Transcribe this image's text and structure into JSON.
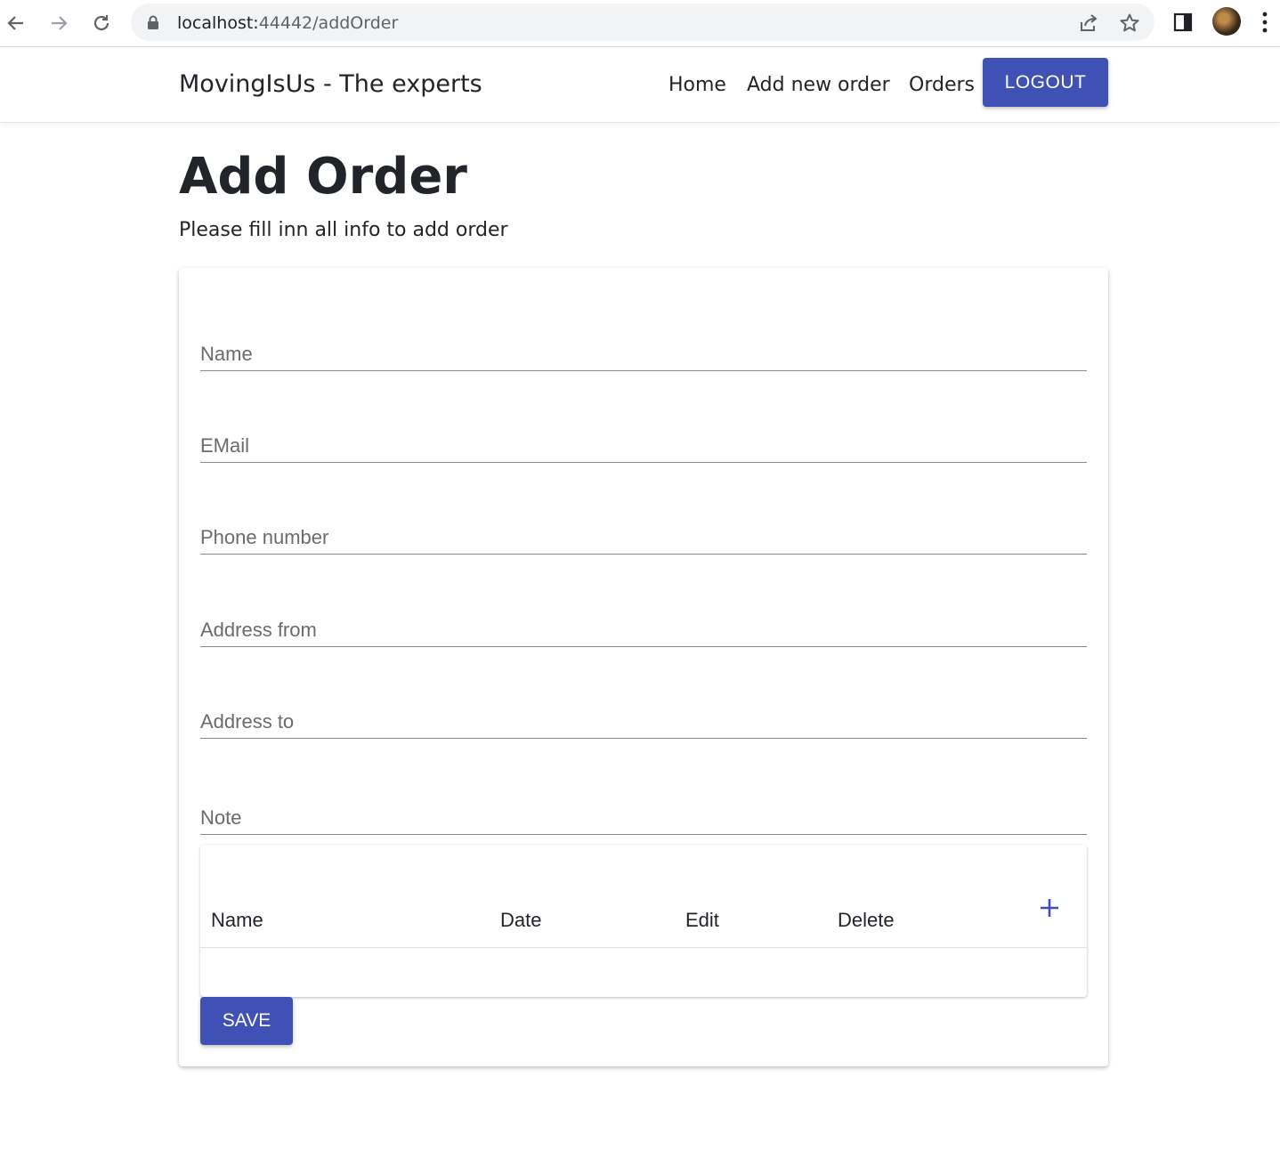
{
  "browser": {
    "url_host": "localhost:",
    "url_path": "44442/addOrder",
    "icons": [
      "back-icon",
      "forward-icon",
      "reload-icon",
      "lock-icon",
      "share-icon",
      "star-icon",
      "side-panel-icon",
      "profile-avatar",
      "menu-dots-icon"
    ]
  },
  "navbar": {
    "brand": "MovingIsUs - The experts",
    "links": [
      "Home",
      "Add new order",
      "Orders"
    ],
    "logout_label": "LOGOUT"
  },
  "page": {
    "title": "Add Order",
    "subtitle": "Please fill inn all info to add order"
  },
  "form": {
    "fields": [
      {
        "placeholder": "Name",
        "value": ""
      },
      {
        "placeholder": "EMail",
        "value": ""
      },
      {
        "placeholder": "Phone number",
        "value": ""
      },
      {
        "placeholder": "Address from",
        "value": ""
      },
      {
        "placeholder": "Address to",
        "value": ""
      },
      {
        "placeholder": "Note",
        "value": ""
      }
    ],
    "table": {
      "headers": [
        "Name",
        "Date",
        "Edit",
        "Delete"
      ],
      "add_icon": "plus-icon",
      "rows": []
    },
    "save_label": "SAVE"
  },
  "colors": {
    "primary": "#3f51b5",
    "text": "#212529",
    "placeholder": "#6b6b6b"
  }
}
